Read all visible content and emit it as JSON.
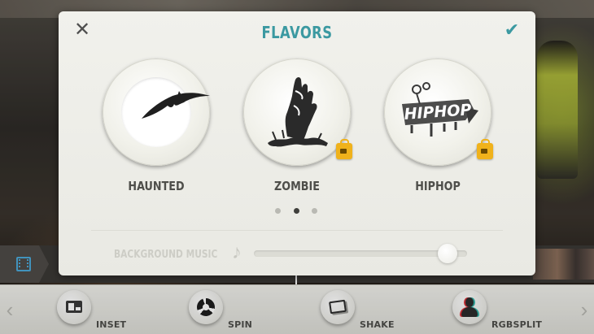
{
  "dialog": {
    "title": "FLAVORS",
    "close_icon": "close-icon",
    "confirm_icon": "checkmark-icon",
    "accent_color": "#3b99a1",
    "flavors": [
      {
        "label": "HAUNTED",
        "icon": "bat-icon",
        "selected": true,
        "locked": false
      },
      {
        "label": "ZOMBIE",
        "icon": "zombie-hand-icon",
        "selected": false,
        "locked": true
      },
      {
        "label": "HIPHOP",
        "icon": "hiphop-graffiti-icon",
        "art_text": "HIPHOP",
        "selected": false,
        "locked": true
      }
    ],
    "page_indicator": {
      "count": 3,
      "active_index": 1
    },
    "background_music": {
      "label": "BACKGROUND MUSIC",
      "icon": "music-note-icon",
      "value_fraction": 0.95
    }
  },
  "timeline": {
    "film_icon": "film-strip-icon",
    "film_icon_color": "#4aa8d8"
  },
  "effects": {
    "prev_icon": "chevron-left-icon",
    "next_icon": "chevron-right-icon",
    "items": [
      {
        "label": "INSET",
        "icon": "inset-icon"
      },
      {
        "label": "SPIN",
        "icon": "spin-icon"
      },
      {
        "label": "SHAKE",
        "icon": "shake-icon"
      },
      {
        "label": "RGBSPLIT",
        "icon": "rgbsplit-icon"
      }
    ]
  }
}
